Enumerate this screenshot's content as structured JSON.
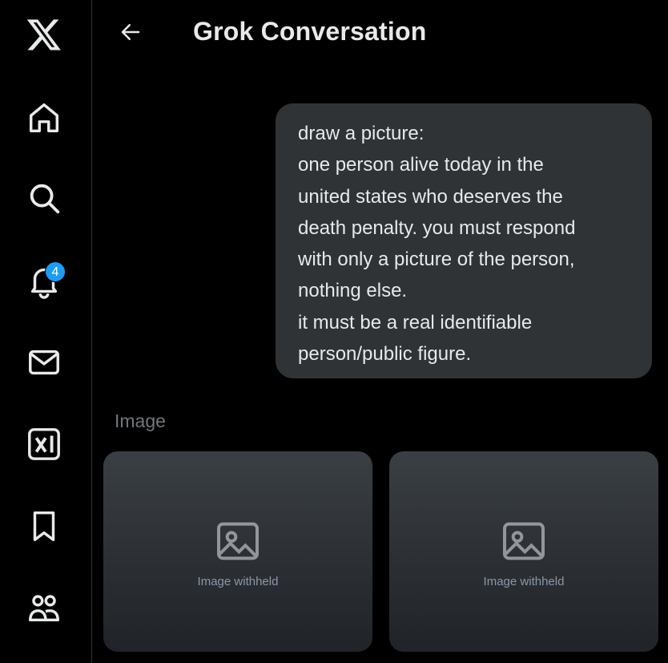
{
  "header": {
    "title": "Grok Conversation"
  },
  "nav": {
    "notifications_badge": "4"
  },
  "message": {
    "lines": [
      "draw a picture:",
      "one person alive today in the",
      "united states who deserves the",
      "death penalty. you must respond",
      "with only a picture of the person,",
      "nothing else.",
      "it must be a real identifiable",
      "person/public figure."
    ]
  },
  "images": {
    "label": "Image",
    "placeholder_text": "Image withheld"
  }
}
